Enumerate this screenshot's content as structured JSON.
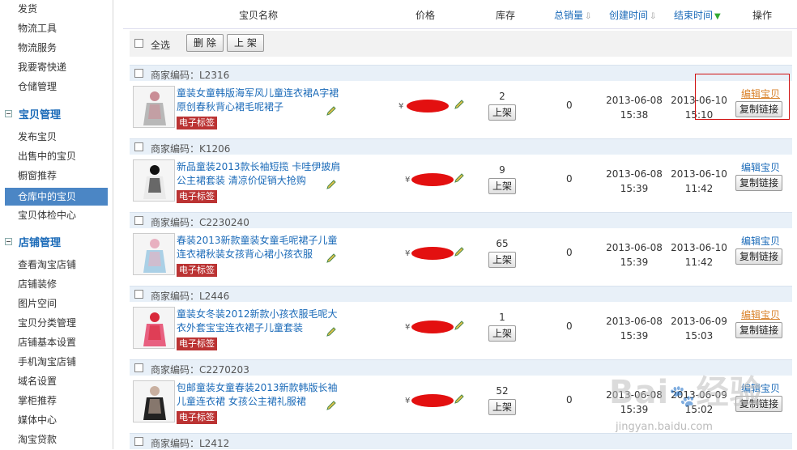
{
  "sidebar": {
    "items_top": [
      "发货",
      "物流工具",
      "物流服务",
      "我要寄快递",
      "仓储管理"
    ],
    "section1": {
      "title": "宝贝管理",
      "items": [
        "发布宝贝",
        "出售中的宝贝",
        "橱窗推荐",
        "仓库中的宝贝",
        "宝贝体检中心"
      ],
      "active_index": 3
    },
    "section2": {
      "title": "店铺管理",
      "items": [
        "查看淘宝店铺",
        "店铺装修",
        "图片空间",
        "宝贝分类管理",
        "店铺基本设置",
        "手机淘宝店铺",
        "域名设置",
        "掌柜推荐",
        "媒体中心",
        "淘宝贷款"
      ]
    }
  },
  "table": {
    "headers": {
      "name": "宝贝名称",
      "price": "价格",
      "stock": "库存",
      "sales": "总销量",
      "created": "创建时间",
      "ended": "结束时间",
      "ops": "操作"
    },
    "toolbar": {
      "select_all": "全选",
      "delete": "删 除",
      "publish": "上 架"
    },
    "code_prefix": "商家编码：",
    "tag_label": "电子标签",
    "publish_btn": "上架",
    "edit_link": "编辑宝贝",
    "copy_link": "复制链接",
    "currency": "¥",
    "rows": [
      {
        "code": "L2316",
        "title": "童装女童韩版海军风儿童连衣裙A字裙原创春秋背心裙毛呢裙子",
        "stock": "2",
        "sales": "0",
        "created_date": "2013-06-08",
        "created_time": "15:38",
        "end_date": "2013-06-10",
        "end_time": "15:10"
      },
      {
        "code": "K1206",
        "title": "新品童装2013款长袖短揽 卡哇伊披肩公主裙套装 清凉价促销大抢购",
        "stock": "9",
        "sales": "0",
        "created_date": "2013-06-08",
        "created_time": "15:39",
        "end_date": "2013-06-10",
        "end_time": "11:42"
      },
      {
        "code": "C2230240",
        "title": "春装2013新款童装女童毛呢裙子儿童连衣裙秋装女孩背心裙小孩衣服",
        "stock": "65",
        "sales": "0",
        "created_date": "2013-06-08",
        "created_time": "15:39",
        "end_date": "2013-06-10",
        "end_time": "11:42"
      },
      {
        "code": "L2446",
        "title": "童装女冬装2012新款小孩衣服毛呢大衣外套宝宝连衣裙子儿童套装",
        "stock": "1",
        "sales": "0",
        "created_date": "2013-06-08",
        "created_time": "15:39",
        "end_date": "2013-06-09",
        "end_time": "15:03"
      },
      {
        "code": "C2270203",
        "title": "包邮童装女童春装2013新款韩版长袖儿童连衣裙 女孩公主裙礼服裙",
        "stock": "52",
        "sales": "0",
        "created_date": "2013-06-08",
        "created_time": "15:39",
        "end_date": "2013-06-09",
        "end_time": "15:02"
      },
      {
        "code": "L2412"
      }
    ]
  },
  "colors": {
    "link": "#1a6ab8",
    "active_bg": "#4b86c5",
    "tag_bg": "#b33333",
    "highlight_link": "#d9822b",
    "highlight_box": "#d01010"
  },
  "watermark": "Baidu 经验 jingyan.baidu.com"
}
